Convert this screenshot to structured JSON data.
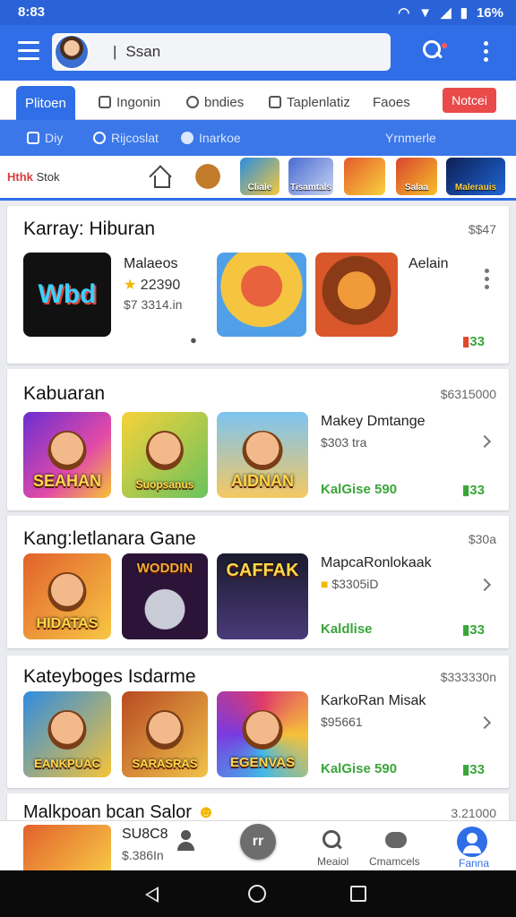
{
  "status_bar": {
    "time": "8:83",
    "battery": "16%"
  },
  "header": {
    "search_text": "Ssan"
  },
  "tabs": [
    {
      "label": "Plitoen"
    },
    {
      "label": "Ingonin"
    },
    {
      "label": "bndies"
    },
    {
      "label": "Taplenlatiz"
    },
    {
      "label": "Faoes"
    }
  ],
  "tab_badge": "Notcei",
  "subtabs": [
    {
      "label": "Diy"
    },
    {
      "label": "Rijcoslat"
    },
    {
      "label": "Inarkoe"
    },
    {
      "label": "Yrnmerle"
    }
  ],
  "strip": {
    "label_prefix": "Hthk",
    "label": "Stok",
    "thumbs": [
      "",
      "Cliale",
      "Tisamtals",
      "",
      "Salaa",
      "Malerauis"
    ]
  },
  "sections": [
    {
      "title": "Karray: Hiburan",
      "right": "$$47",
      "featured_logo": "Wbd",
      "name": "Malaeos",
      "rating": "22390",
      "price": "$7 3314.in",
      "extra_name": "Aelain",
      "tiles": [
        "",
        ""
      ],
      "icon_label": "33"
    },
    {
      "title": "Kabuaran",
      "right": "$6315000",
      "tiles": [
        "SEAHAN",
        "Suopsanus",
        "AIDNAN"
      ],
      "name": "Makey Dmtange",
      "price": "$303 tra",
      "rating": "KalGise 590",
      "icon_label": "33"
    },
    {
      "title": "Kang:letlanara Gane",
      "right": "$30a",
      "tiles": [
        "HIDATAS",
        "WODDIN",
        "CAFFAK"
      ],
      "name": "MapcaRonlokaak",
      "price": "$3305iD",
      "rating": "Kaldlise",
      "icon_label": "33"
    },
    {
      "title": "Kateyboges Isdarme",
      "right": "$333330n",
      "tiles": [
        "EANKPUAC",
        "SARASRAS",
        "EGENVAS"
      ],
      "name": "KarkoRan Misak",
      "price": "$95661",
      "rating": "KalGise 590",
      "icon_label": "33"
    },
    {
      "title": "Malkpoan bcan Salor",
      "right": "3.21000",
      "name": "SU8C8",
      "price": "$.386In"
    }
  ],
  "bottom_nav": {
    "center": "rr",
    "items": [
      {
        "label": "Meaiol"
      },
      {
        "label": "Cmamcels"
      },
      {
        "label": "Fanna"
      }
    ]
  },
  "colors": {
    "primary": "#2f6ee6",
    "badge": "#ea4a4a",
    "rating_green": "#3aa53a"
  }
}
